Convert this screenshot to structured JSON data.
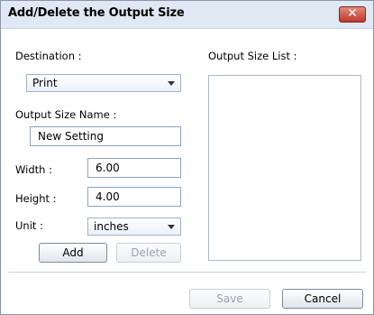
{
  "dialog": {
    "title": "Add/Delete the Output Size"
  },
  "form": {
    "destination_label": "Destination :",
    "destination_value": "Print",
    "output_size_name_label": "Output Size Name :",
    "output_size_name_value": "New Setting",
    "width_label": "Width :",
    "width_value": "6.00",
    "height_label": "Height :",
    "height_value": "4.00",
    "unit_label": "Unit :",
    "unit_value": "inches",
    "add_label": "Add",
    "delete_label": "Delete"
  },
  "list": {
    "label": "Output Size List :",
    "items": []
  },
  "footer": {
    "save_label": "Save",
    "cancel_label": "Cancel"
  },
  "icons": {
    "close": "close-icon",
    "dropdown": "chevron-down-icon"
  },
  "colors": {
    "title_bar": "#dfe8f3",
    "close_button": "#c0392b"
  }
}
